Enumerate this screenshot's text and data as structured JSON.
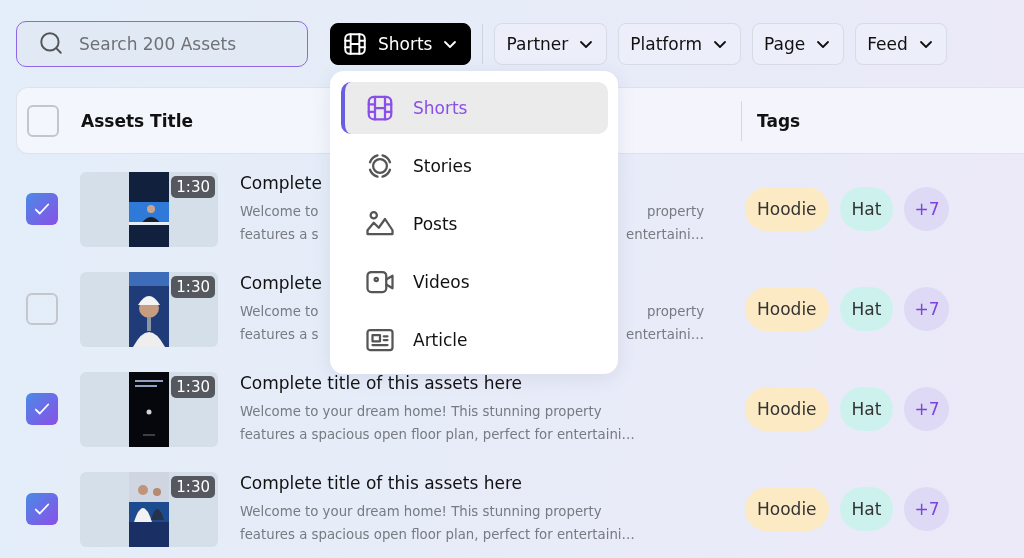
{
  "search": {
    "placeholder": "Search 200 Assets"
  },
  "filters": [
    {
      "label": "Shorts",
      "active": true,
      "expanded": true
    },
    {
      "label": "Partner",
      "active": false,
      "expanded": false
    },
    {
      "label": "Platform",
      "active": false,
      "expanded": false
    },
    {
      "label": "Page",
      "active": false,
      "expanded": false
    },
    {
      "label": "Feed",
      "active": false,
      "expanded": false
    }
  ],
  "menu": {
    "items": [
      {
        "label": "Shorts",
        "selected": true
      },
      {
        "label": "Stories",
        "selected": false
      },
      {
        "label": "Posts",
        "selected": false
      },
      {
        "label": "Videos",
        "selected": false
      },
      {
        "label": "Article",
        "selected": false
      }
    ]
  },
  "table": {
    "select_all": {
      "checked": false
    },
    "columns": [
      "Assets Title",
      "Tags"
    ],
    "rows": [
      {
        "checked": true,
        "duration": "1:30",
        "title": "Complete",
        "description": [
          [
            "Welcome to",
            "property"
          ],
          [
            "features a s",
            "entertaini…"
          ]
        ],
        "tags": [
          {
            "label": "Hoodie",
            "color": "#fbeac3"
          },
          {
            "label": "Hat",
            "color": "#cdf2ee"
          }
        ],
        "more": "+7"
      },
      {
        "checked": false,
        "duration": "1:30",
        "title": "Complete",
        "description": [
          [
            "Welcome to",
            "property"
          ],
          [
            "features a s",
            "entertaini…"
          ]
        ],
        "tags": [
          {
            "label": "Hoodie",
            "color": "#fbeac3"
          },
          {
            "label": "Hat",
            "color": "#cdf2ee"
          }
        ],
        "more": "+7"
      },
      {
        "checked": true,
        "duration": "1:30",
        "title": "Complete title of this assets here",
        "description": [
          [
            "Welcome to your dream home! This stunning property"
          ],
          [
            "features a spacious open floor plan, perfect for entertaini…"
          ]
        ],
        "tags": [
          {
            "label": "Hoodie",
            "color": "#fbeac3"
          },
          {
            "label": "Hat",
            "color": "#cdf2ee"
          }
        ],
        "more": "+7"
      },
      {
        "checked": true,
        "duration": "1:30",
        "title": "Complete title of this assets here",
        "description": [
          [
            "Welcome to your dream home! This stunning property"
          ],
          [
            "features a spacious open floor plan, perfect for entertaini…"
          ]
        ],
        "tags": [
          {
            "label": "Hoodie",
            "color": "#fbeac3"
          },
          {
            "label": "Hat",
            "color": "#cdf2ee"
          }
        ],
        "more": "+7"
      }
    ]
  }
}
